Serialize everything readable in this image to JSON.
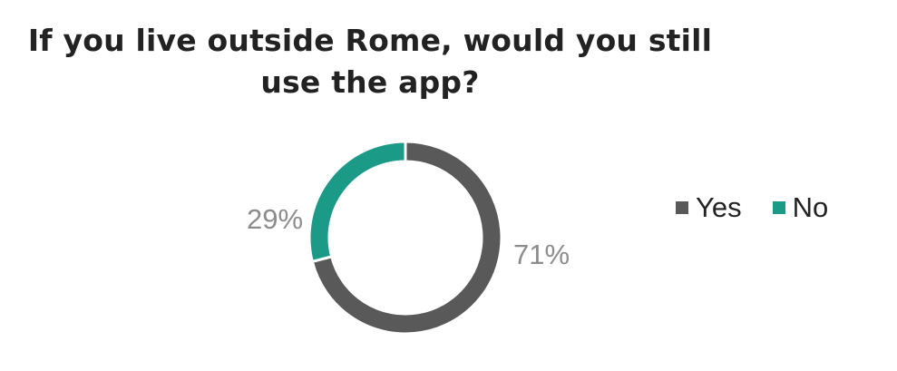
{
  "chart_data": {
    "type": "pie",
    "title": "If you live outside Rome, would you still use the app?",
    "title_lines": [
      "If you live outside Rome, would you still",
      "use the app?"
    ],
    "categories": [
      "Yes",
      "No"
    ],
    "values": [
      71,
      29
    ],
    "labels": [
      "71%",
      "29%"
    ],
    "colors": [
      "#595959",
      "#1a9a87"
    ],
    "donut": true,
    "legend_position": "right"
  }
}
